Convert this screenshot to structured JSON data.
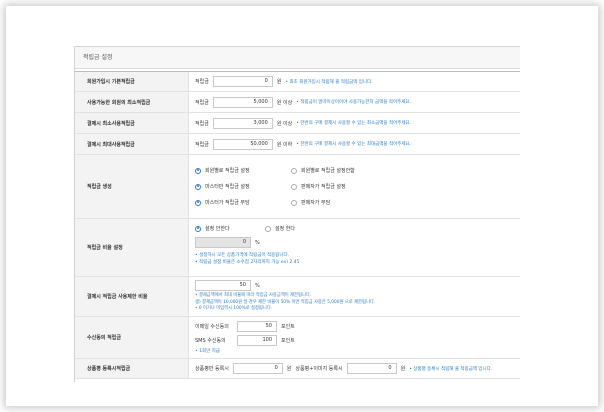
{
  "panel_title": "적립금 설정",
  "rows": {
    "signup": {
      "label": "회원가입시 기본적립금",
      "prefix": "적립금",
      "value": "0",
      "unit": "원",
      "note": "• 최초 회원가입시 적립해 줄 적립금액 입니다."
    },
    "min_available": {
      "label": "사용가능한 회원의 최소적립금",
      "prefix": "적립금",
      "value": "5,000",
      "unit": "원 이상",
      "note": "• 적립금이 얼마이상이어야 사용가능한지 금액을 적어주세요."
    },
    "min_use": {
      "label": "결제시 최소사용적립금",
      "prefix": "적립금",
      "value": "3,000",
      "unit": "원 이상",
      "note": "• 한번의 구매 결제시 사용할 수 있는 최소금액을 적어주세요."
    },
    "max_use": {
      "label": "결제시 최대사용적립금",
      "prefix": "적립금",
      "value": "50,000",
      "unit": "원 이하",
      "note": "• 한번의 구매 결제시 사용할 수 있는 최대금액을 적어주세요."
    },
    "method": {
      "label": "적립금 생성",
      "options": [
        {
          "label": "회원별로 적립금 설정",
          "checked": true
        },
        {
          "label": "회원별로 적립금 설정안함",
          "checked": false
        },
        {
          "label": "마스터만 적립금 설정",
          "checked": true
        },
        {
          "label": "판매자가 적립금 설정",
          "checked": false
        },
        {
          "label": "마스터가 적립금 부담",
          "checked": true
        },
        {
          "label": "판매자가 부담",
          "checked": false
        }
      ]
    },
    "ratio": {
      "label": "적립금 비율 설정",
      "options": [
        {
          "label": "설정 안한다",
          "checked": true
        },
        {
          "label": "설정 한다",
          "checked": false
        }
      ],
      "value": "0",
      "unit": "%",
      "notes": [
        "• 설정하시 모든 상품가격에 적립금이 적용됩니다.",
        "• 적립금 설정 비율은 소수점 2자리까지 가능 ex) 2.45"
      ]
    },
    "limit": {
      "label": "결제시 적립금 사용제한 비율",
      "value": "50",
      "unit": "%",
      "notes": [
        "• 결제금액에서 최대 비율에 따라 적립금 사용금액이 제한됩니다.",
        "  생) 결제금액이 10,000원 일 경우 제한 비율이 50% 이면 적립금 사용은 5,000원 으로 제한됩니다.",
        "• 0 이거나 미입력시 100%로 설정됩니다."
      ]
    },
    "receive": {
      "label": "수신동의 적립금",
      "email_label": "이메일 수신동의",
      "email_value": "50",
      "sms_label": "SMS 수신동의",
      "sms_value": "100",
      "unit": "포인트",
      "note": "• 1회만 지급"
    },
    "review": {
      "label": "상품평 등록시적립금",
      "general_label": "상품평만 등록시",
      "general_value": "0",
      "photo_label": "상품평+이미지 등록시",
      "photo_value": "0",
      "unit": "원",
      "note": "• 상품평 등록시 적립해 줄 적립금액 입니다."
    }
  }
}
